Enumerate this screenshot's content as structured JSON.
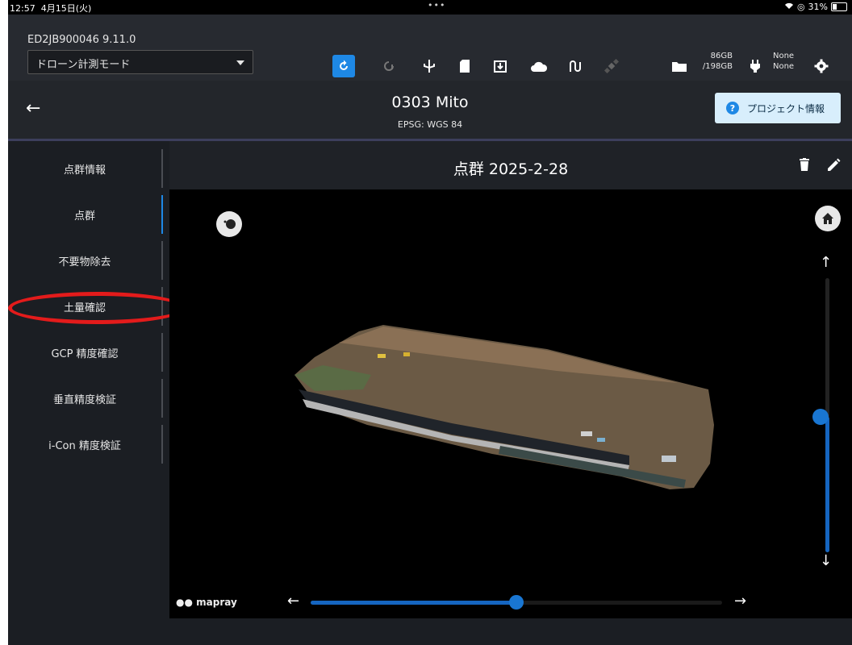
{
  "status_bar": {
    "time": "12:57",
    "date": "4月15日(火)",
    "dots": "•••",
    "battery": "31%"
  },
  "toolbar": {
    "device_id": "ED2JB900046   9.11.0",
    "mode": "ドローン計測モード",
    "storage_used": "86GB",
    "storage_total": "/198GB",
    "status_1": "None",
    "status_2": "None"
  },
  "project": {
    "title": "0303 Mito",
    "epsg": "EPSG: WGS 84",
    "info_button": "プロジェクト情報"
  },
  "sidebar": {
    "items": [
      {
        "label": "点群情報"
      },
      {
        "label": "点群"
      },
      {
        "label": "不要物除去"
      },
      {
        "label": "土量確認"
      },
      {
        "label": "GCP 精度確認"
      },
      {
        "label": "垂直精度検証"
      },
      {
        "label": "i-Con 精度検証"
      }
    ],
    "active_index": 1
  },
  "content": {
    "title": "点群 2025-2-28"
  },
  "viewer": {
    "logo": "mapray",
    "vertical_slider_value": 0.6,
    "horizontal_slider_value": 0.5
  },
  "colors": {
    "accent": "#1e88e5",
    "highlight": "#e31b1b"
  }
}
